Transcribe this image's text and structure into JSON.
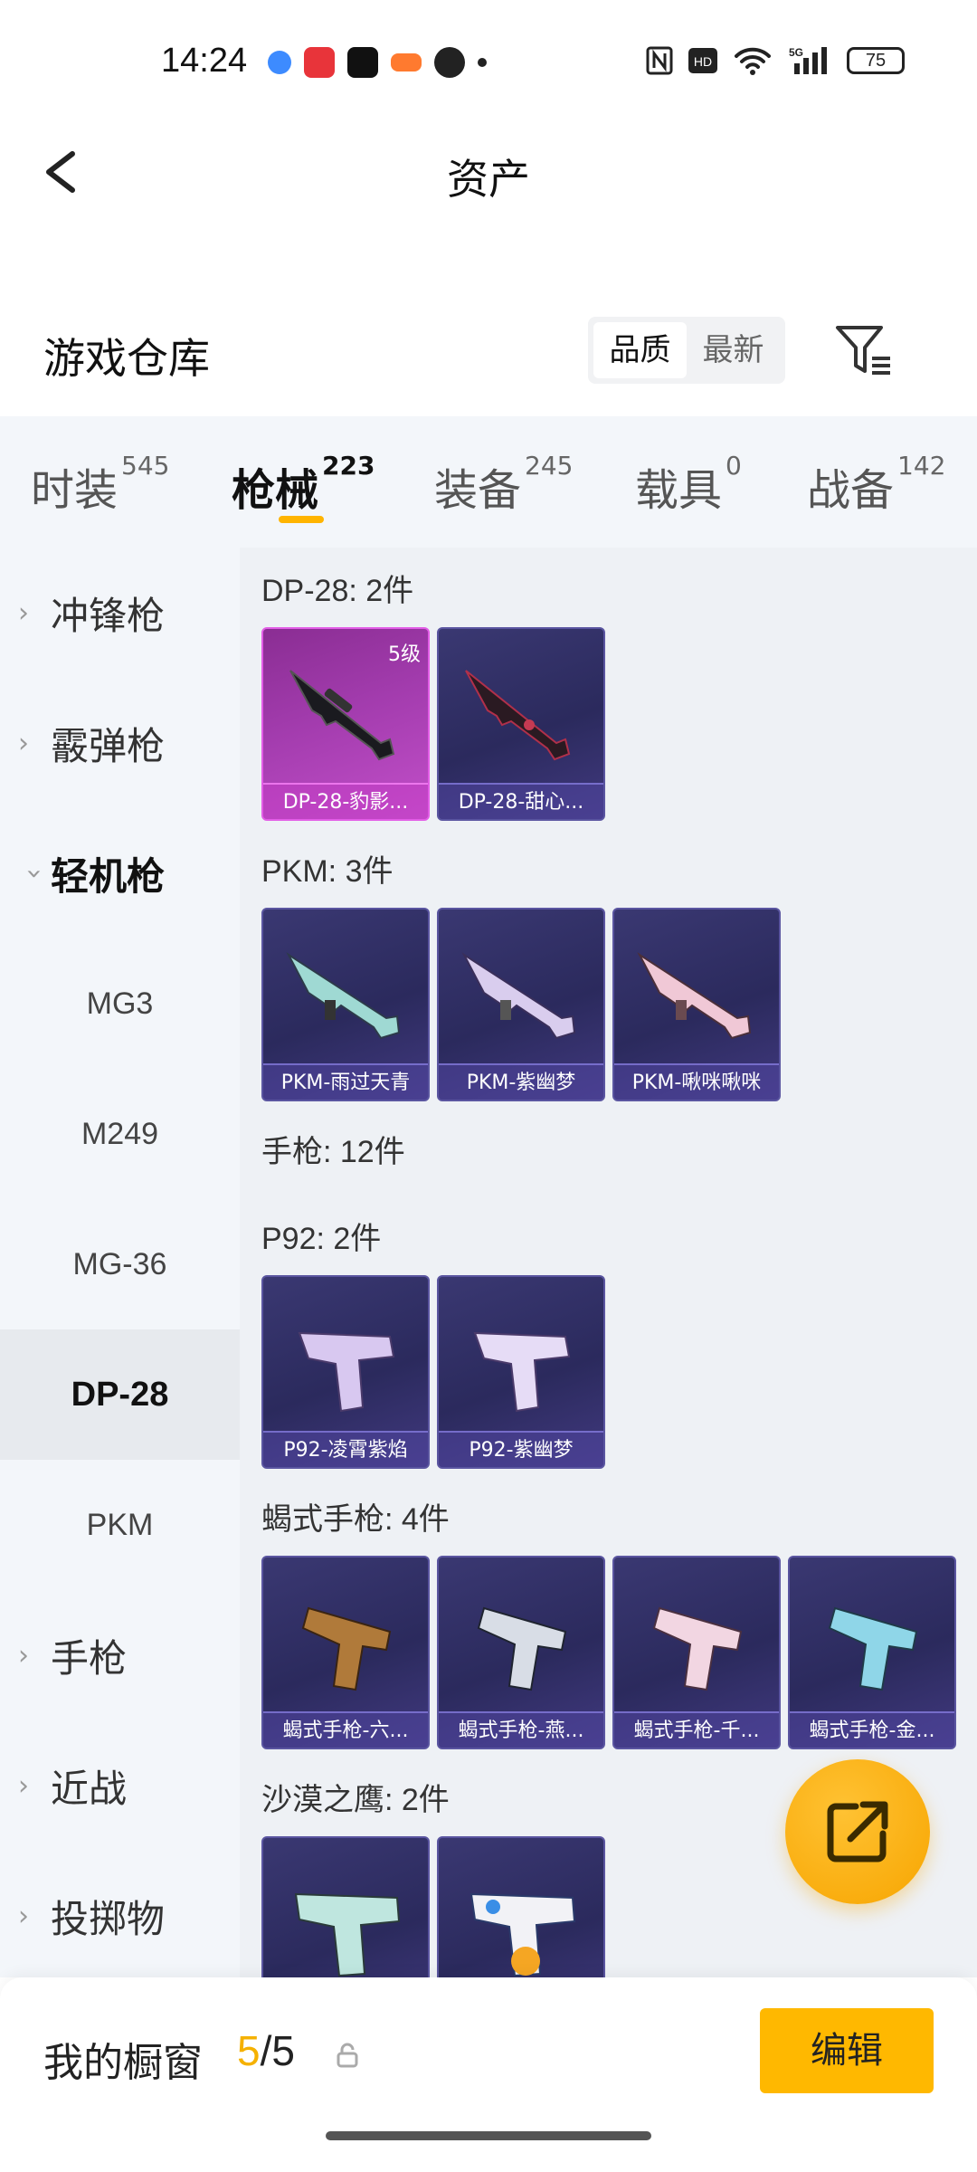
{
  "status_bar": {
    "time": "14:24",
    "battery": "75"
  },
  "header": {
    "title": "资产"
  },
  "warehouse": {
    "title": "游戏仓库",
    "sort_options": [
      "品质",
      "最新"
    ],
    "active_sort": "品质"
  },
  "tabs": [
    {
      "label": "时装",
      "count": "545"
    },
    {
      "label": "枪械",
      "count": "223"
    },
    {
      "label": "装备",
      "count": "245"
    },
    {
      "label": "载具",
      "count": "0"
    },
    {
      "label": "战备",
      "count": "142"
    }
  ],
  "active_tab": "枪械",
  "sidebar": {
    "categories": [
      "冲锋枪",
      "霰弹枪",
      "轻机枪",
      "手枪",
      "近战",
      "投掷物"
    ],
    "open_category": "轻机枪",
    "subitems": [
      "MG3",
      "M249",
      "MG-36",
      "DP-28",
      "PKM"
    ],
    "active_subitem": "DP-28"
  },
  "groups": [
    {
      "title": "DP-28: 2件",
      "items": [
        {
          "name": "DP-28-豹影...",
          "level": "5级",
          "rarity": "pink"
        },
        {
          "name": "DP-28-甜心...",
          "rarity": "purple"
        }
      ]
    },
    {
      "title": "PKM: 3件",
      "items": [
        {
          "name": "PKM-雨过天青",
          "rarity": "purple"
        },
        {
          "name": "PKM-紫幽梦",
          "rarity": "purple"
        },
        {
          "name": "PKM-啾咪啾咪",
          "rarity": "purple"
        }
      ]
    },
    {
      "title": "手枪: 12件"
    },
    {
      "title": "P92: 2件",
      "items": [
        {
          "name": "P92-凌霄紫焰",
          "rarity": "purple"
        },
        {
          "name": "P92-紫幽梦",
          "rarity": "purple"
        }
      ]
    },
    {
      "title": "蝎式手枪: 4件",
      "items": [
        {
          "name": "蝎式手枪-六...",
          "rarity": "purple"
        },
        {
          "name": "蝎式手枪-燕...",
          "rarity": "purple"
        },
        {
          "name": "蝎式手枪-千...",
          "rarity": "purple"
        },
        {
          "name": "蝎式手枪-金...",
          "rarity": "purple"
        }
      ]
    },
    {
      "title": "沙漠之鹰: 2件"
    }
  ],
  "showcase": {
    "label": "我的橱窗",
    "current": "5",
    "separator": "/",
    "total": "5",
    "edit_label": "编辑"
  },
  "colors": {
    "accent": "#ffb800",
    "rarity_pink": "#c24fc9",
    "rarity_purple": "#3a3872"
  }
}
